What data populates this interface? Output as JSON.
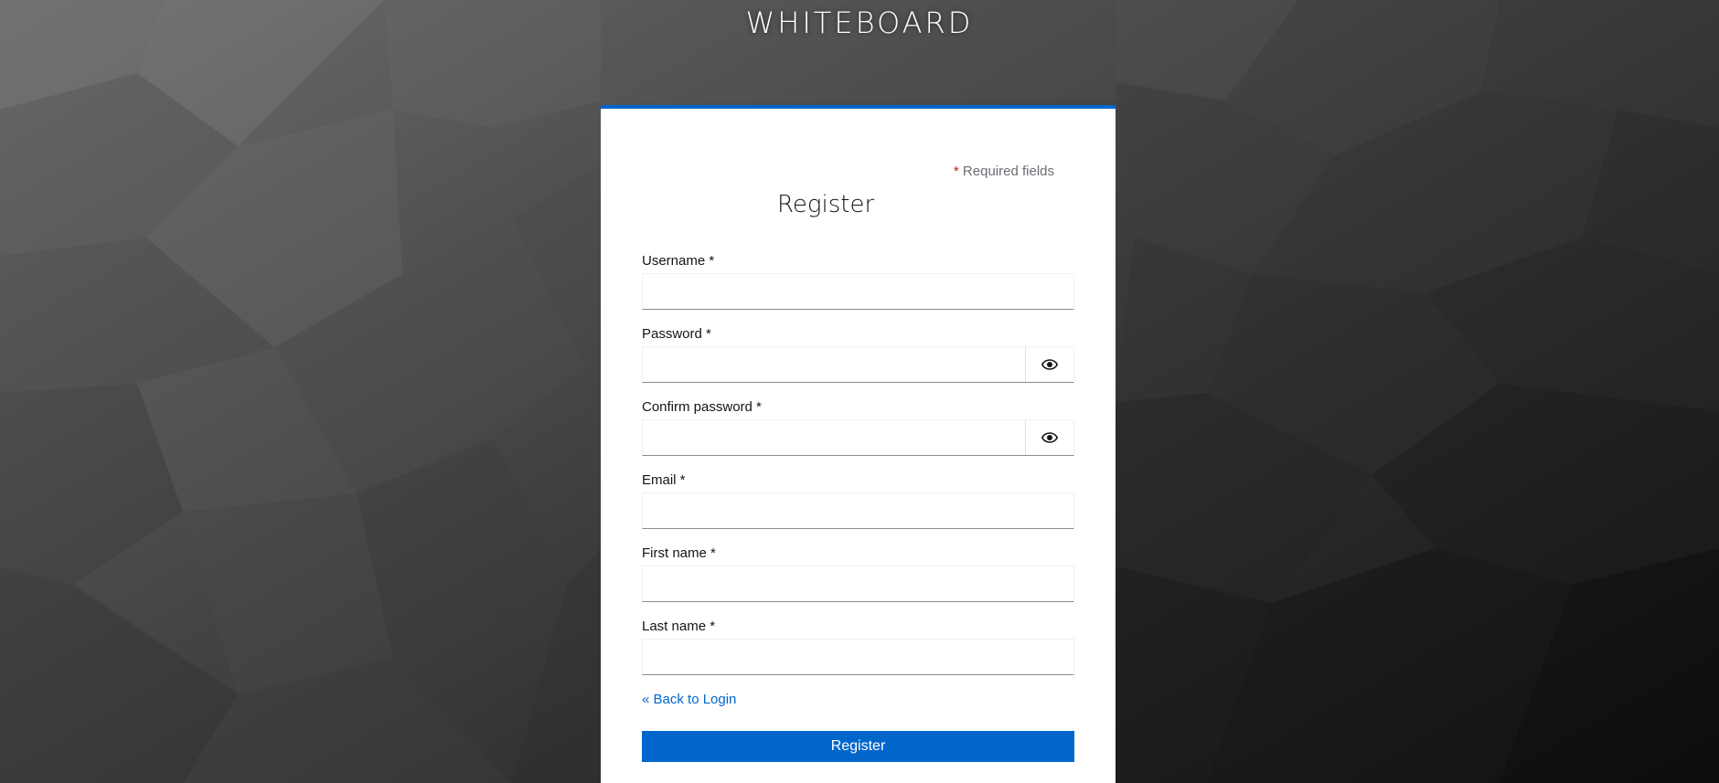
{
  "brand": {
    "title": "WHITEBOARD"
  },
  "form": {
    "required_star": "*",
    "required_text": " Required fields",
    "title": "Register",
    "fields": [
      {
        "label": "Username *",
        "value": "",
        "placeholder": "",
        "type": "text"
      },
      {
        "label": "Password *",
        "value": "",
        "placeholder": "",
        "type": "password",
        "toggle_icon": "eye-icon"
      },
      {
        "label": "Confirm password *",
        "value": "",
        "placeholder": "",
        "type": "password",
        "toggle_icon": "eye-icon"
      },
      {
        "label": "Email *",
        "value": "",
        "placeholder": "",
        "type": "text"
      },
      {
        "label": "First name *",
        "value": "",
        "placeholder": "",
        "type": "text"
      },
      {
        "label": "Last name *",
        "value": "",
        "placeholder": "",
        "type": "text"
      }
    ],
    "back_link": "« Back to Login",
    "submit_label": "Register"
  },
  "colors": {
    "accent": "#0066cc",
    "required_star": "#c9190b",
    "card_background": "#ffffff"
  }
}
